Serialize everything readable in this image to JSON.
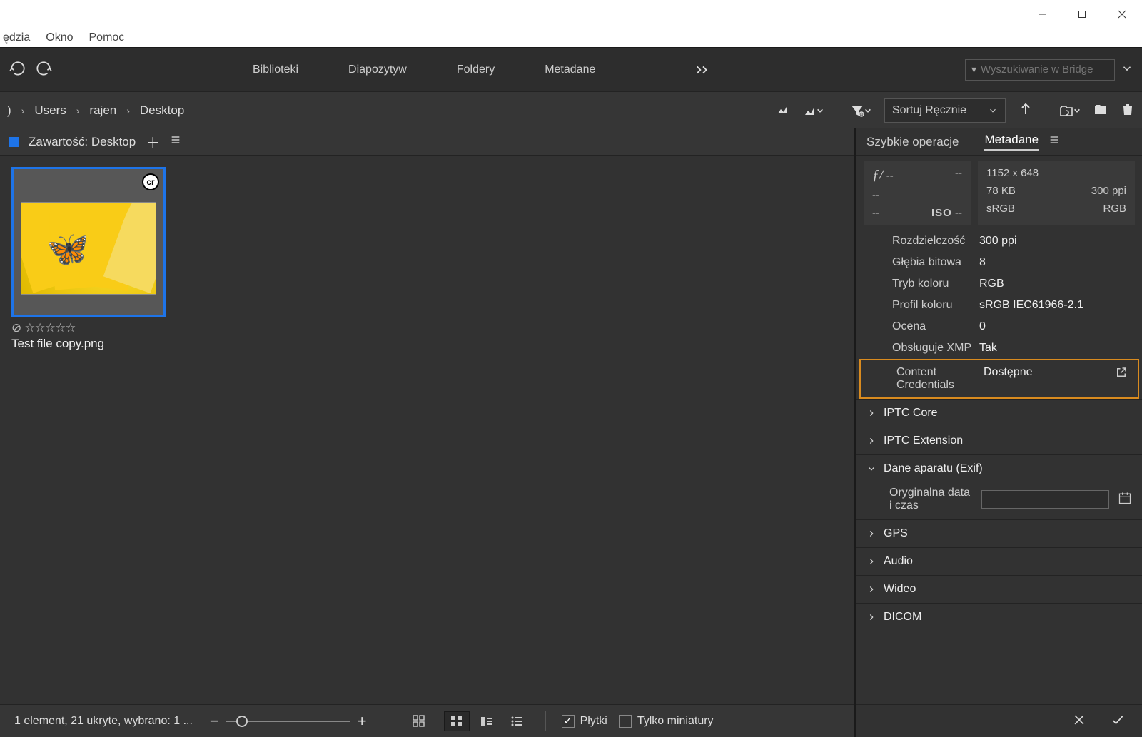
{
  "menubar": {
    "items": [
      "ędzia",
      "Okno",
      "Pomoc"
    ]
  },
  "toolbar1": {
    "workspaces": [
      "Biblioteki",
      "Diapozytyw",
      "Foldery",
      "Metadane"
    ],
    "search_placeholder": "Wyszukiwanie w Bridge"
  },
  "breadcrumb": {
    "items": [
      "Users",
      "rajen",
      "Desktop"
    ]
  },
  "sort": {
    "label": "Sortuj Ręcznie"
  },
  "content": {
    "header": "Zawartość: Desktop",
    "file_name": "Test file copy.png",
    "cr_badge": "cr"
  },
  "statusbar": {
    "text": "1 element, 21 ukryte, wybrano: 1 ...",
    "tiles_label": "Płytki",
    "thumbs_only_label": "Tylko miniatury"
  },
  "rightpanel": {
    "tabs": {
      "quick": "Szybkie operacje",
      "meta": "Metadane"
    },
    "summary": {
      "fstop_label": "ƒ/",
      "fstop_value": "--",
      "shutter": "--",
      "ev": "--",
      "flash": "--",
      "iso_label": "ISO",
      "iso_value": "--",
      "dimensions": "1152 x 648",
      "size": "78 KB",
      "ppi": "300 ppi",
      "colorspace": "sRGB",
      "colormode": "RGB"
    },
    "properties": [
      {
        "k": "Rozdzielczość",
        "v": "300 ppi"
      },
      {
        "k": "Głębia bitowa",
        "v": "8"
      },
      {
        "k": "Tryb koloru",
        "v": "RGB"
      },
      {
        "k": "Profil koloru",
        "v": "sRGB IEC61966-2.1"
      },
      {
        "k": "Ocena",
        "v": "0"
      },
      {
        "k": "Obsługuje XMP",
        "v": "Tak"
      }
    ],
    "content_credentials": {
      "k": "Content Credentials",
      "v": "Dostępne"
    },
    "sections": {
      "iptc_core": "IPTC Core",
      "iptc_ext": "IPTC Extension",
      "exif": "Dane aparatu (Exif)",
      "exif_date_label": "Oryginalna data i czas",
      "gps": "GPS",
      "audio": "Audio",
      "wideo": "Wideo",
      "dicom": "DICOM"
    }
  }
}
